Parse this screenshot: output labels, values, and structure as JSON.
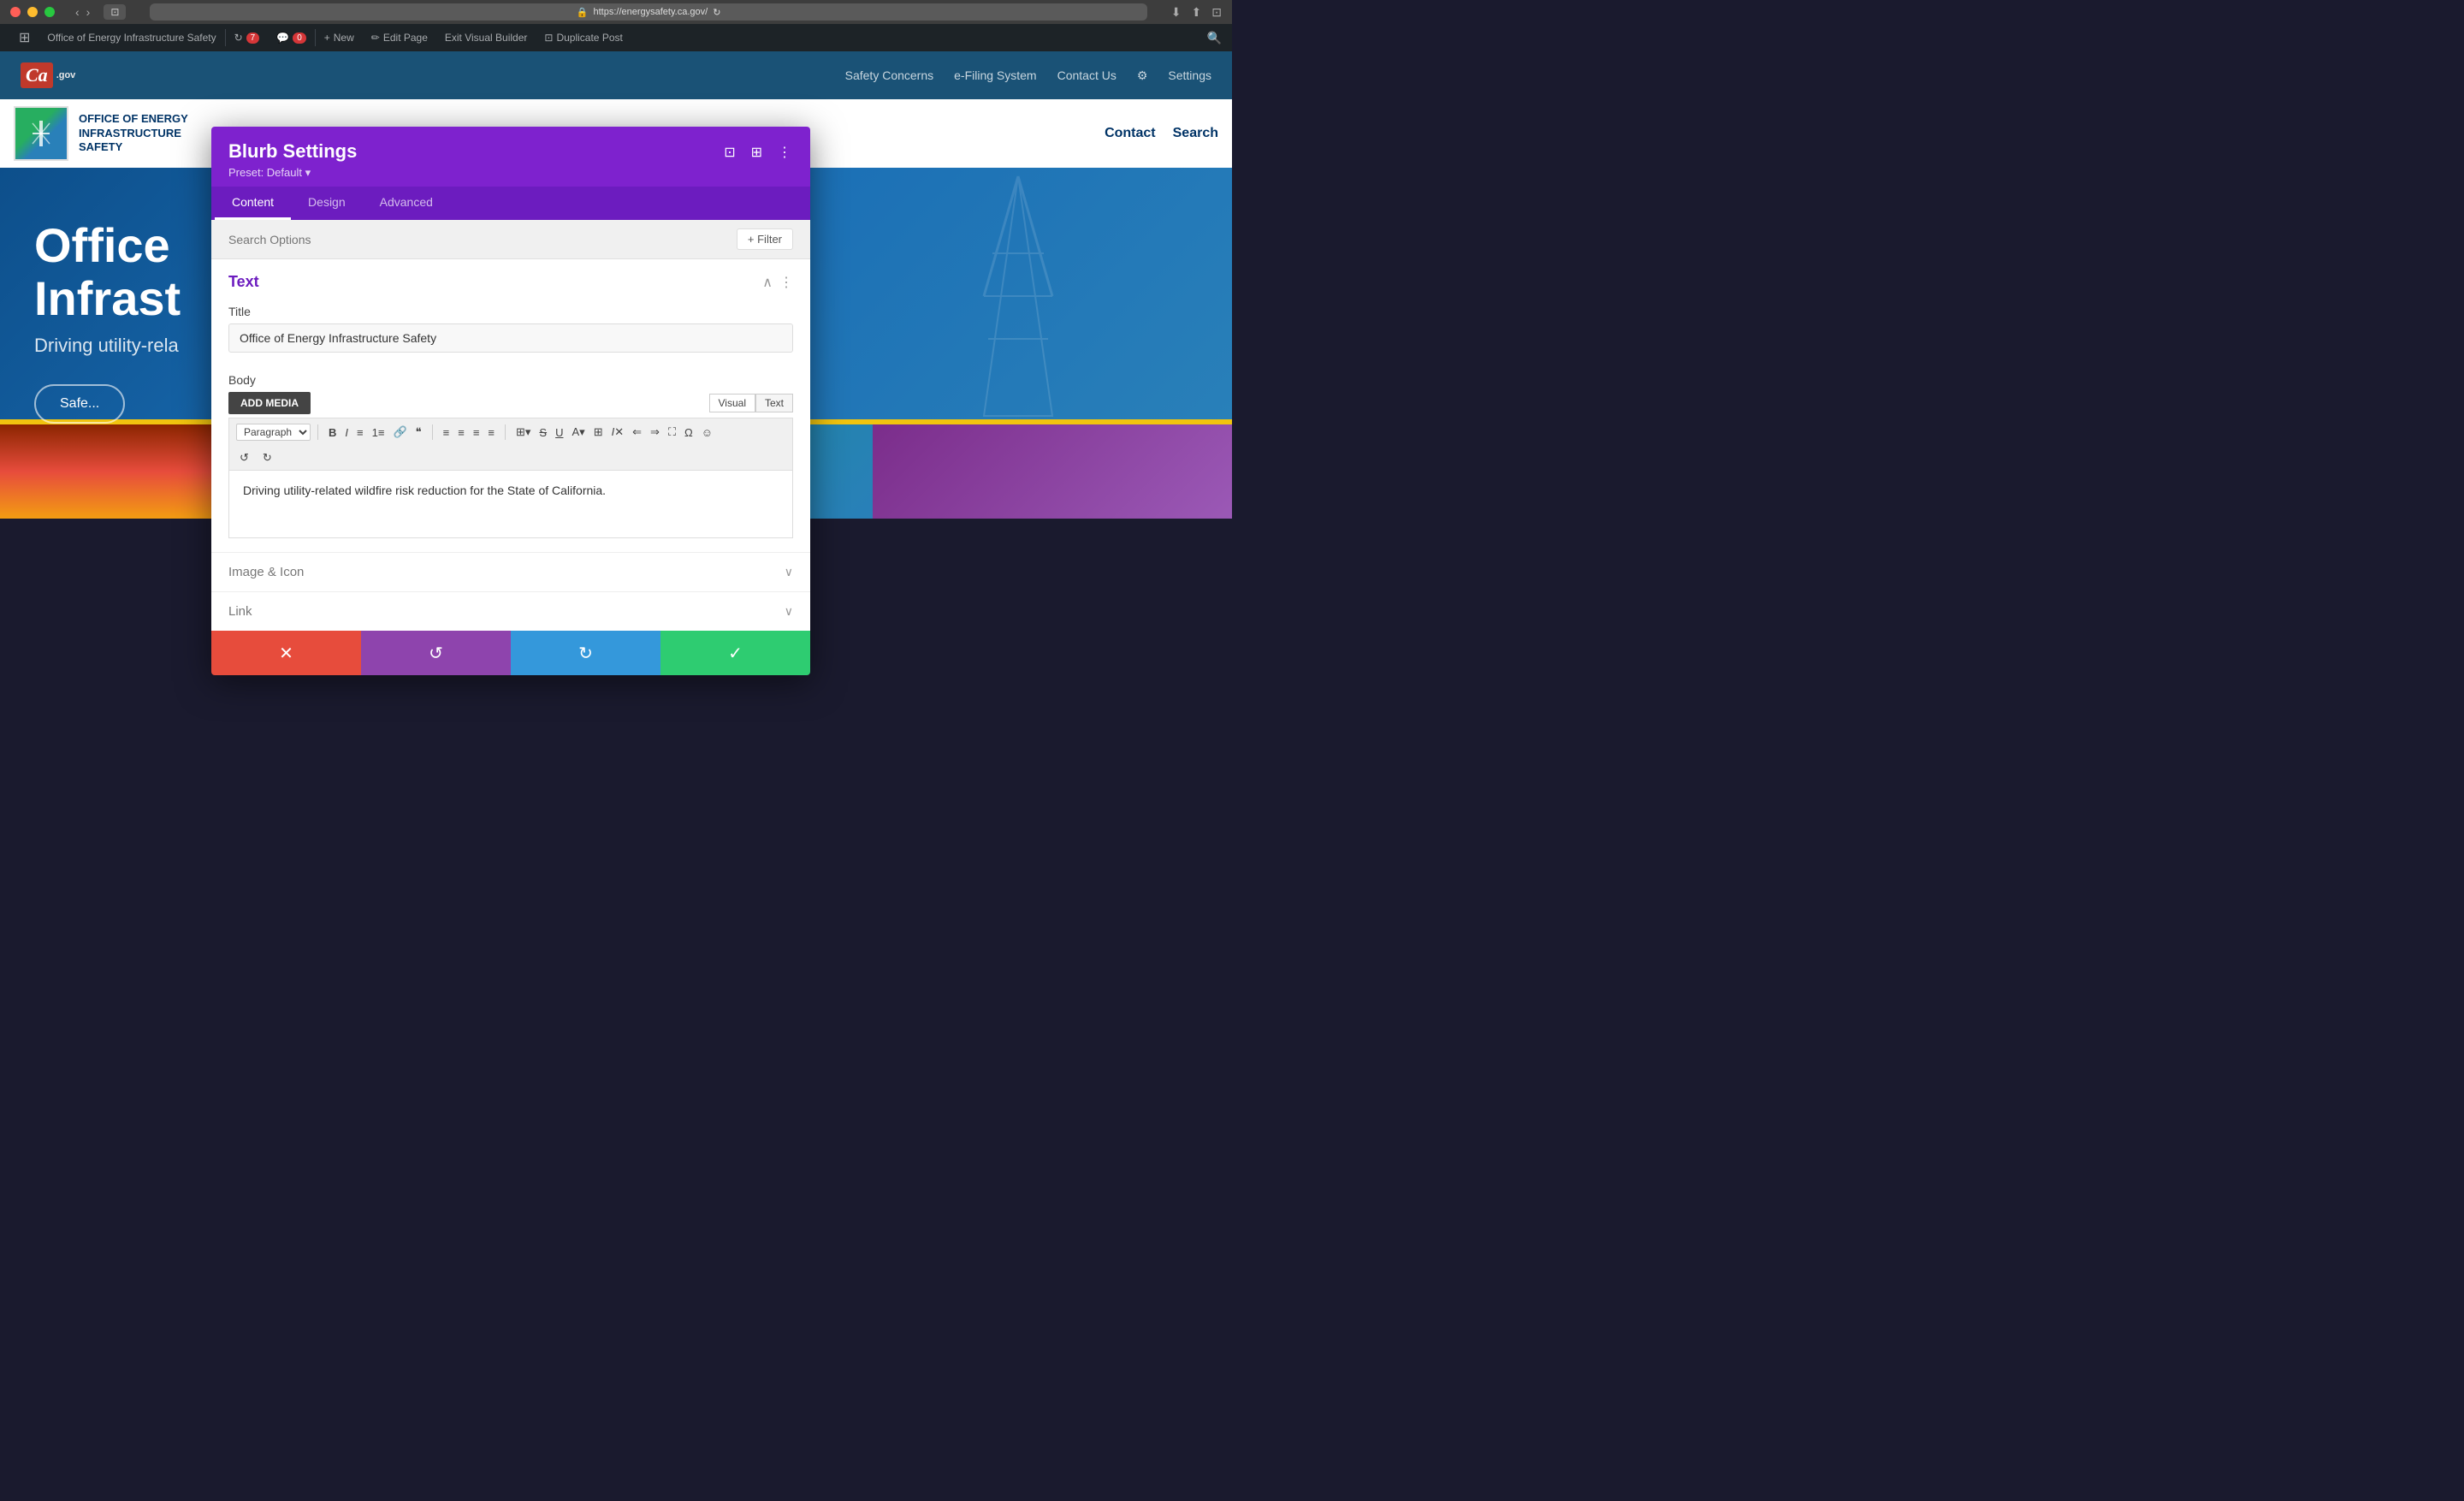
{
  "mac": {
    "address": "https://energysafety.ca.gov/",
    "btns": [
      "close",
      "minimize",
      "maximize"
    ]
  },
  "admin_bar": {
    "wp_icon": "⊞",
    "site_name": "Office of Energy Infrastructure Safety",
    "updates_count": "7",
    "comments_count": "0",
    "new_label": "New",
    "edit_label": "Edit Page",
    "exit_label": "Exit Visual Builder",
    "duplicate_label": "Duplicate Post"
  },
  "site_header": {
    "ca_logo_text": "CA",
    "ca_gov_text": ".gov",
    "nav_items": [
      "Safety Concerns",
      "e-Filing System",
      "Contact Us"
    ],
    "settings_label": "Settings"
  },
  "site_subheader": {
    "org_name_line1": "OFFICE OF ENERGY",
    "org_name_line2": "INFRASTRUCTURE",
    "org_name_line3": "SAFETY",
    "nav_contact": "Contact",
    "nav_search": "Search"
  },
  "hero": {
    "title_line1": "Office",
    "title_line2": "Infrast",
    "subtitle": "Driving utility-rela",
    "cta_btn": "Safe...",
    "yellow_bar": true
  },
  "modal": {
    "title": "Blurb Settings",
    "preset_label": "Preset: Default ▾",
    "tabs": [
      "Content",
      "Design",
      "Advanced"
    ],
    "active_tab": "Content",
    "search_placeholder": "Search Options",
    "filter_btn": "+ Filter",
    "text_section_title": "Text",
    "title_label": "Title",
    "title_value": "Office of Energy Infrastructure Safety",
    "body_label": "Body",
    "add_media_btn": "ADD MEDIA",
    "visual_tab": "Visual",
    "text_tab": "Text",
    "toolbar_paragraph": "Paragraph",
    "body_text": "Driving utility-related wildfire risk reduction for the State of California.",
    "image_icon_label": "Image & Icon",
    "link_label": "Link",
    "footer": {
      "cancel_icon": "✕",
      "reset_icon": "↺",
      "redo_icon": "↻",
      "save_icon": "✓"
    },
    "dots": [
      "dot",
      "dot",
      "dot-active"
    ]
  },
  "bottom_section": {
    "dots_count": 3
  }
}
